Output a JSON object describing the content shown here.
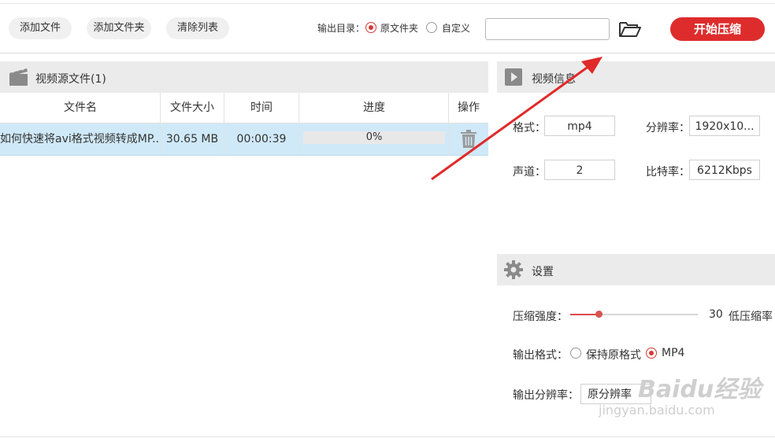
{
  "toolbar": {
    "add_file": "添加文件",
    "add_folder": "添加文件夹",
    "clear_list": "清除列表",
    "output_dir_label": "输出目录：",
    "option_original": "原文件夹",
    "option_custom": "自定义",
    "selected_option": "原文件夹",
    "path_value": "",
    "start": "开始压缩"
  },
  "source_panel": {
    "title": "视频源文件(1)",
    "columns": [
      "文件名",
      "文件大小",
      "时间",
      "进度",
      "操作"
    ],
    "rows": [
      {
        "name": "如何快速将avi格式视频转成MP...",
        "size": "30.65 MB",
        "duration": "00:00:39",
        "progress": "0%",
        "progress_value": 0
      }
    ]
  },
  "video_info": {
    "title": "视频信息",
    "format_label": "格式：",
    "format_value": "mp4",
    "resolution_label": "分辨率：",
    "resolution_value": "1920x10...",
    "channels_label": "声道：",
    "channels_value": "2",
    "bitrate_label": "比特率：",
    "bitrate_value": "6212Kbps"
  },
  "settings": {
    "title": "设置",
    "strength_label": "压缩强度：",
    "strength_value": "30",
    "strength_desc": "低压缩率",
    "strength_fraction": 0.22,
    "format_label": "输出格式：",
    "format_keep": "保持原格式",
    "format_mp4": "MP4",
    "selected_format": "MP4",
    "resolution_label": "输出分辨率：",
    "resolution_value": "原分辨率"
  },
  "watermark": {
    "brand": "Baidu经验",
    "url": "jingyan.baidu.com"
  },
  "colors": {
    "accent": "#de2c2c",
    "row_selected": "#cfe9f8",
    "panel_header": "#ebebeb",
    "arrow": "#e02a2a"
  }
}
